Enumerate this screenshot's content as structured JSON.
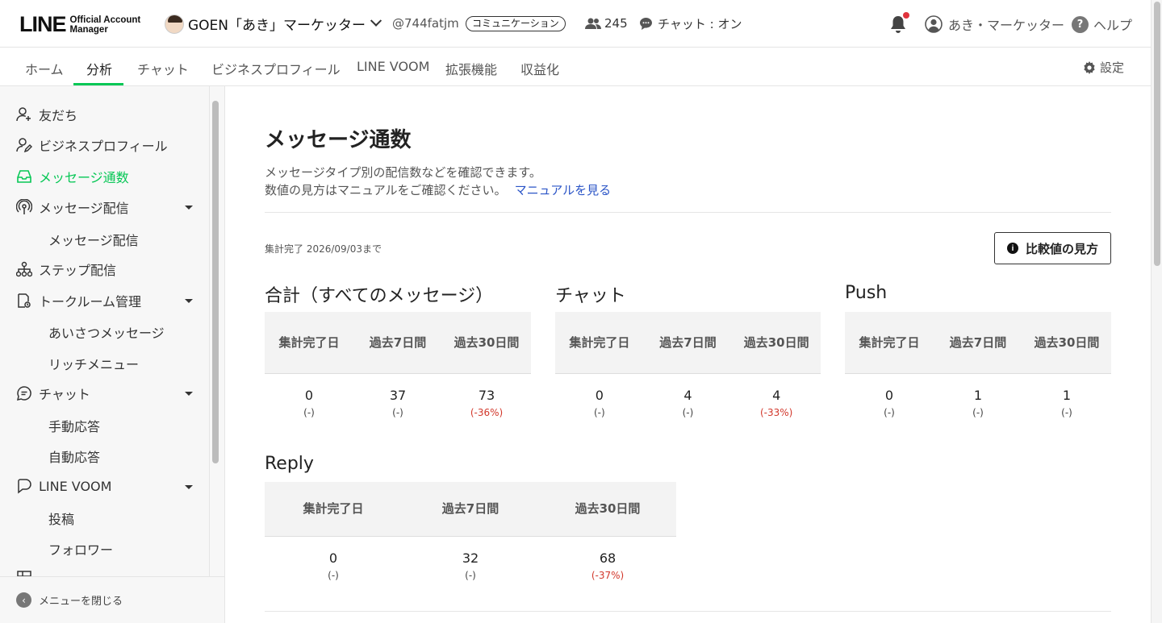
{
  "header": {
    "logo_big": "LINE",
    "logo_small_1": "Official Account",
    "logo_small_2": "Manager",
    "account_name": "GOEN「あき」マーケッター",
    "account_id": "@744fatjm",
    "category_badge": "コミュニケーション",
    "friend_count": "245",
    "chat_status": "チャット : オン",
    "user_name": "あき・マーケッター",
    "help_label": "ヘルプ"
  },
  "nav": {
    "tabs": [
      "ホーム",
      "分析",
      "チャット",
      "ビジネスプロフィール",
      "LINE VOOM",
      "拡張機能",
      "収益化"
    ],
    "active_tab": "分析",
    "settings_label": "設定"
  },
  "sidebar": {
    "items": [
      {
        "label": "友だち",
        "icon": "person-add-icon"
      },
      {
        "label": "ビジネスプロフィール",
        "icon": "profile-icon"
      },
      {
        "label": "メッセージ通数",
        "icon": "inbox-icon",
        "active": true
      },
      {
        "label": "メッセージ配信",
        "icon": "broadcast-icon"
      },
      {
        "label": "メッセージ配信",
        "sub": true
      },
      {
        "label": "ステップ配信",
        "icon": "step-icon"
      },
      {
        "label": "トークルーム管理",
        "icon": "talkroom-icon"
      },
      {
        "label": "あいさつメッセージ",
        "sub": true
      },
      {
        "label": "リッチメニュー",
        "sub": true
      },
      {
        "label": "チャット",
        "icon": "chat-icon"
      },
      {
        "label": "手動応答",
        "sub": true
      },
      {
        "label": "自動応答",
        "sub": true
      },
      {
        "label": "LINE VOOM",
        "icon": "voom-icon"
      },
      {
        "label": "投稿",
        "sub": true
      },
      {
        "label": "フォロワー",
        "sub": true
      }
    ],
    "collapse_label": "メニューを閉じる"
  },
  "main": {
    "title": "メッセージ通数",
    "desc_line1": "メッセージタイプ別の配信数などを確認できます。",
    "desc_line2": "数値の見方はマニュアルをご確認ください。",
    "manual_link": "マニュアルを見る",
    "aggregation_note": "集計完了 2026/09/03まで",
    "compare_button": "比較値の見方",
    "columns": [
      "集計完了日",
      "過去7日間",
      "過去30日間"
    ],
    "sections": [
      {
        "title": "合計（すべてのメッセージ）",
        "values": [
          "0",
          "37",
          "73"
        ],
        "changes": [
          "(-)",
          "(-)",
          "(-36%)"
        ]
      },
      {
        "title": "チャット",
        "values": [
          "0",
          "4",
          "4"
        ],
        "changes": [
          "(-)",
          "(-)",
          "(-33%)"
        ]
      },
      {
        "title": "Push",
        "values": [
          "0",
          "1",
          "1"
        ],
        "changes": [
          "(-)",
          "(-)",
          "(-)"
        ]
      },
      {
        "title": "Reply",
        "values": [
          "0",
          "32",
          "68"
        ],
        "changes": [
          "(-)",
          "(-)",
          "(-37%)"
        ]
      }
    ]
  },
  "colors": {
    "accent": "#06c755",
    "negative": "#d2382c",
    "link": "#2b55c7"
  }
}
